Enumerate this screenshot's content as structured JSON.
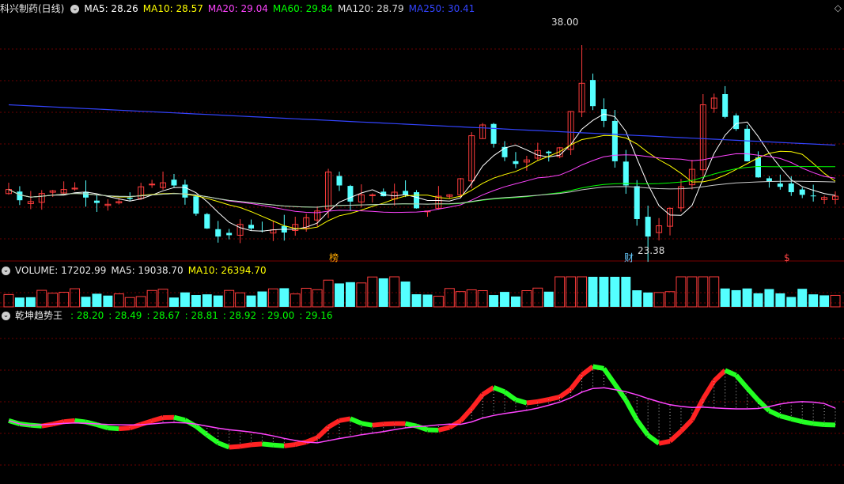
{
  "panel_main": {
    "stock_name": "科兴制药(日线)",
    "ma_labels": [
      "MA5: 28.26",
      "MA10: 28.57",
      "MA20: 29.04",
      "MA60: 29.84",
      "MA120: 28.79",
      "MA250: 30.41"
    ],
    "ma_colors": [
      "#ffffff",
      "#ffff00",
      "#ff44ff",
      "#00ff00",
      "#cccccc",
      "#3344ff"
    ],
    "annotations": {
      "high_label": "38.00",
      "low_label": "23.38"
    },
    "markers": [
      "榜",
      "财",
      "$"
    ]
  },
  "panel_volume": {
    "title": "VOLUME: 17202.99",
    "ma5": "MA5: 19038.70",
    "ma10": "MA10: 26394.70"
  },
  "panel_indicator": {
    "title": "乾坤趋势王",
    "values": [
      ": 28.20",
      ": 28.49",
      ": 28.67",
      ": 28.81",
      ": 28.92",
      ": 29.00",
      ": 29.16"
    ]
  },
  "chart_data": [
    {
      "type": "candlestick",
      "ylim": [
        22,
        40
      ],
      "series_close": [
        27.2,
        26.4,
        26.3,
        26.9,
        27.1,
        27.2,
        27.3,
        26.6,
        26.2,
        26.1,
        26.3,
        26.5,
        27.4,
        27.6,
        27.7,
        27.5,
        26.6,
        25.4,
        24.3,
        23.7,
        23.8,
        24.6,
        24.3,
        24.1,
        24.2,
        24.0,
        24.6,
        25.1,
        25.6,
        28.5,
        27.5,
        26.3,
        26.8,
        26.8,
        26.7,
        27.0,
        26.8,
        25.8,
        25.6,
        26.7,
        26.8,
        28.0,
        31.2,
        32.0,
        30.6,
        29.6,
        29.1,
        29.4,
        30.1,
        29.9,
        30.3,
        33.0,
        35.1,
        33.4,
        32.3,
        29.3,
        27.5,
        25.0,
        23.7,
        24.5,
        25.8,
        27.4,
        28.7,
        33.5,
        34.0,
        32.6,
        31.7,
        29.3,
        28.1,
        27.8,
        27.4,
        27.0,
        26.8,
        26.7,
        26.6,
        26.7
      ],
      "ma_lines": [
        "MA5",
        "MA10",
        "MA20",
        "MA60",
        "MA120",
        "MA250"
      ]
    },
    {
      "type": "bar",
      "name": "VOLUME",
      "ylim": [
        0,
        40000
      ]
    },
    {
      "type": "line",
      "name": "乾坤趋势王",
      "ylim": [
        20,
        40
      ]
    }
  ]
}
